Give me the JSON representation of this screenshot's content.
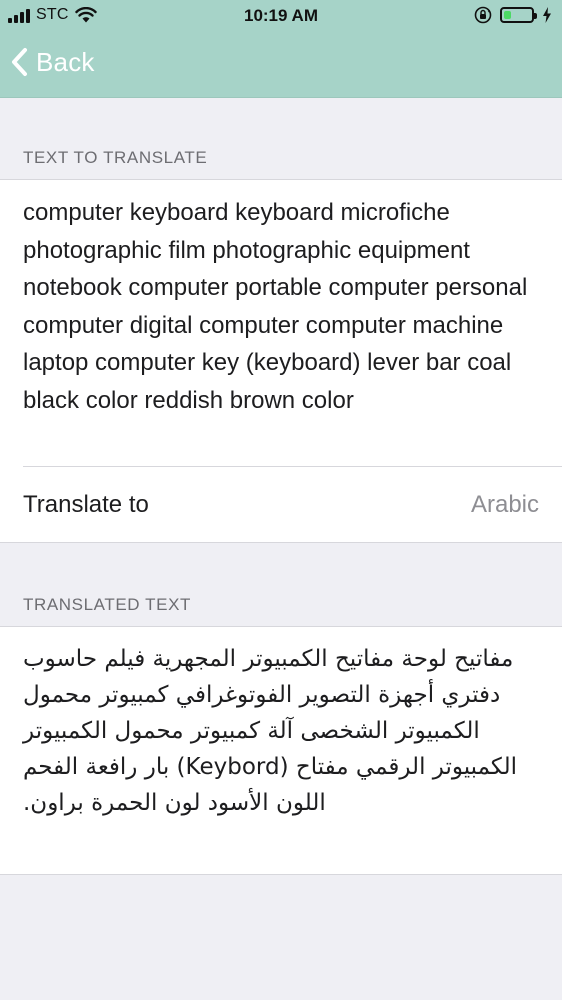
{
  "status_bar": {
    "carrier": "STC",
    "time": "10:19 AM",
    "battery_level": 0.25,
    "battery_color": "#4cd964"
  },
  "nav": {
    "back_label": "Back",
    "back_icon": "chevron-left-icon",
    "bar_color": "#a6d3c8"
  },
  "source": {
    "header": "TEXT TO TRANSLATE",
    "text": "computer keyboard keyboard microfiche photographic film photographic equipment notebook computer portable computer personal computer digital computer computer machine laptop computer key (keyboard) lever bar coal black color reddish brown color"
  },
  "translate_to": {
    "label": "Translate to",
    "value": "Arabic"
  },
  "translated": {
    "header": "TRANSLATED TEXT",
    "text": "مفاتيح لوحة مفاتيح الكمبيوتر المجهرية فيلم حاسوب دفتري أجهزة التصوير الفوتوغرافي كمبيوتر محمول الكمبيوتر الشخصى آلة كمبيوتر محمول الكمبيوتر الكمبيوتر الرقمي مفتاح (Keybord) بار رافعة الفحم اللون الأسود لون الحمرة براون."
  }
}
